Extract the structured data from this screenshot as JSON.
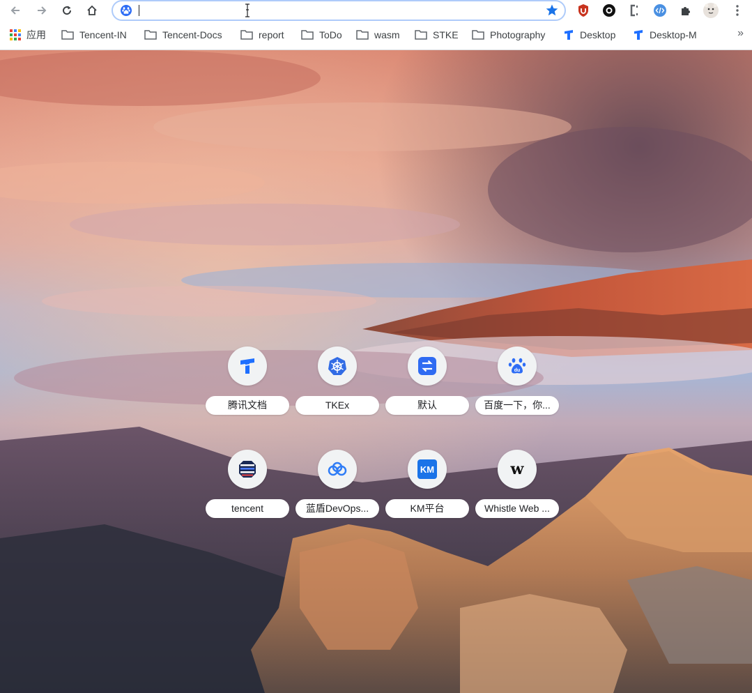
{
  "browser": {
    "omnibox": {
      "value": "",
      "placeholder": ""
    },
    "accent_color": "#1a73e8"
  },
  "bookmarks": {
    "apps_label": "应用",
    "items": [
      {
        "label": "Tencent-IN",
        "icon": "folder-icon"
      },
      {
        "label": "Tencent-Docs",
        "icon": "folder-icon"
      },
      {
        "label": "report",
        "icon": "folder-icon"
      },
      {
        "label": "ToDo",
        "icon": "folder-icon"
      },
      {
        "label": "wasm",
        "icon": "folder-icon"
      },
      {
        "label": "STKE",
        "icon": "folder-icon"
      },
      {
        "label": "Photography",
        "icon": "folder-icon"
      },
      {
        "label": "Desktop",
        "icon": "tencent-docs-icon"
      },
      {
        "label": "Desktop-M",
        "icon": "tencent-docs-icon"
      }
    ],
    "more_label": "»"
  },
  "shortcuts": [
    {
      "label": "腾讯文档",
      "icon": "tencent-docs-icon"
    },
    {
      "label": "TKEx",
      "icon": "kubernetes-icon"
    },
    {
      "label": "默认",
      "icon": "swap-icon"
    },
    {
      "label": "百度一下，你...",
      "icon": "baidu-icon"
    },
    {
      "label": "tencent",
      "icon": "tencent-stack-icon"
    },
    {
      "label": "蓝盾DevOps...",
      "icon": "cloud-icon"
    },
    {
      "label": "KM平台",
      "icon": "km-icon",
      "icon_text": "KM"
    },
    {
      "label": "Whistle Web ...",
      "icon": "whistle-icon",
      "icon_text": "w"
    }
  ],
  "extensions": [
    {
      "icon": "ublock-icon"
    },
    {
      "icon": "circle-ring-icon"
    },
    {
      "icon": "c-bracket-icon"
    },
    {
      "icon": "code-icon"
    },
    {
      "icon": "puzzle-icon"
    },
    {
      "icon": "avatar"
    }
  ]
}
